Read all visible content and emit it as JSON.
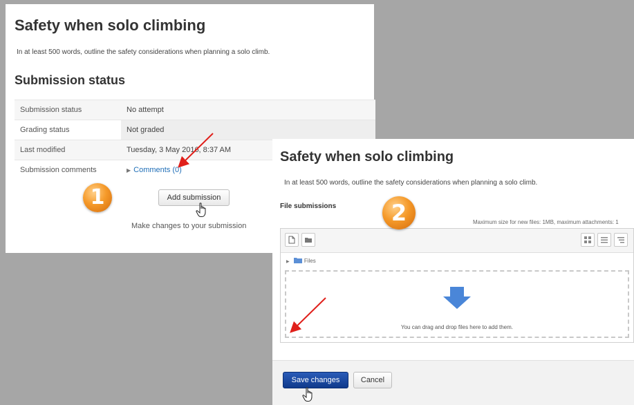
{
  "panel1": {
    "title": "Safety when solo climbing",
    "description": "In at least 500 words, outline the safety considerations when planning a solo climb.",
    "section_heading": "Submission status",
    "rows": [
      {
        "label": "Submission status",
        "value": "No attempt"
      },
      {
        "label": "Grading status",
        "value": "Not graded"
      },
      {
        "label": "Last modified",
        "value": "Tuesday, 3 May 2016, 8:37 AM"
      },
      {
        "label": "Submission comments",
        "value": "Comments (0)"
      }
    ],
    "add_submission_label": "Add submission",
    "make_changes_text": "Make changes to your submission",
    "step_badge": "1"
  },
  "panel2": {
    "title": "Safety when solo climbing",
    "description": "In at least 500 words, outline the safety considerations when planning a solo climb.",
    "file_submissions_label": "File submissions",
    "max_size_text": "Maximum size for new files: 1MB, maximum attachments: 1",
    "files_path_label": "Files",
    "drop_text": "You can drag and drop files here to add them.",
    "save_label": "Save changes",
    "cancel_label": "Cancel",
    "step_badge": "2"
  },
  "colors": {
    "background": "#a6a6a6",
    "link": "#1f6eb7",
    "primary_button": "#1a4aa6",
    "badge": "#f59a2a",
    "arrow": "#e0201b",
    "drop_arrow": "#4a86d8"
  },
  "icons": [
    "add-file-icon",
    "create-folder-icon",
    "icon-view-icon",
    "list-view-icon",
    "tree-view-icon",
    "folder-icon",
    "download-arrow-icon",
    "hand-cursor-icon",
    "red-arrow-icon"
  ]
}
